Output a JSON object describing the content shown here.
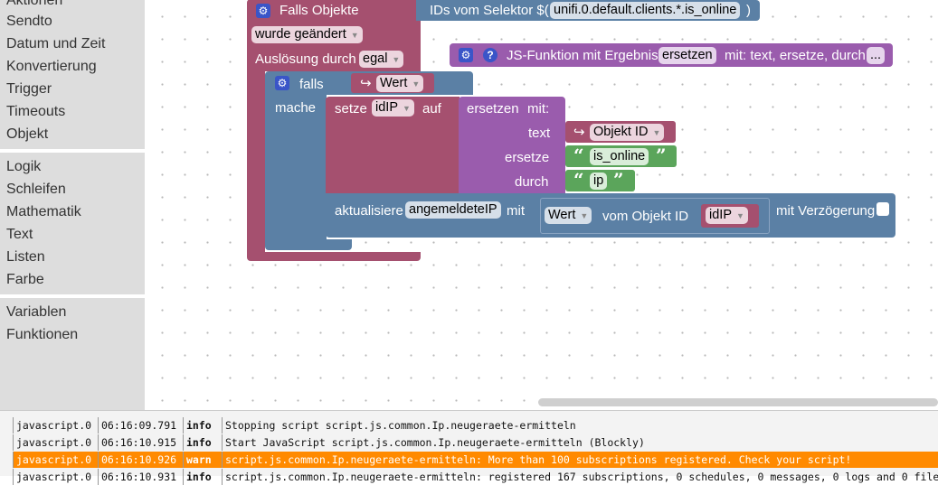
{
  "sidebar": {
    "categories": [
      "Aktionen",
      "Sendto",
      "Datum und Zeit",
      "Konvertierung",
      "Trigger",
      "Timeouts",
      "Objekt",
      "Logik",
      "Schleifen",
      "Mathematik",
      "Text",
      "Listen",
      "Farbe",
      "Variablen",
      "Funktionen"
    ]
  },
  "blocks": {
    "trigger": {
      "title": "Falls Objekte",
      "ids_label": "IDs vom Selektor $(",
      "selector": "unifi.0.default.clients.*.is_online",
      "close_paren": ")",
      "changed": "wurde geändert",
      "triggered_by": "Auslösung durch",
      "trigger_type": "egal"
    },
    "if_block": {
      "if_label": "falls",
      "value": "Wert",
      "do_label": "mache"
    },
    "set_var": {
      "label": "setze",
      "var": "idIP",
      "to": "auf"
    },
    "replace": {
      "label": "ersetzen",
      "with": "mit:",
      "text_label": "text",
      "text_value": "Objekt ID",
      "replace_label": "ersetze",
      "replace_value": "is_online",
      "by_label": "durch",
      "by_value": "ip"
    },
    "js_function": {
      "title": "JS-Funktion mit Ergebnis",
      "name": "ersetzen",
      "params": "mit: text, ersetze, durch",
      "more": "..."
    },
    "update": {
      "label": "aktualisiere",
      "var": "angemeldeteIP",
      "with": "mit",
      "value": "Wert",
      "from_object": "vom Objekt ID",
      "object_var": "idIP",
      "delay": "mit Verzögerung"
    }
  },
  "log": {
    "rows": [
      {
        "source": "javascript.0",
        "time": "06:16:09.791",
        "level": "info",
        "message": "Stopping script script.js.common.Ip.neugeraete-ermitteln"
      },
      {
        "source": "javascript.0",
        "time": "06:16:10.915",
        "level": "info",
        "message": "Start JavaScript script.js.common.Ip.neugeraete-ermitteln (Blockly)"
      },
      {
        "source": "javascript.0",
        "time": "06:16:10.926",
        "level": "warn",
        "message": "script.js.common.Ip.neugeraete-ermitteln: More than 100 subscriptions registered. Check your script!"
      },
      {
        "source": "javascript.0",
        "time": "06:16:10.931",
        "level": "info",
        "message": "script.js.common.Ip.neugeraete-ermitteln: registered 167 subscriptions, 0 schedules, 0 messages, 0 logs and 0 file"
      }
    ]
  },
  "colors": {
    "trigger": "#a5506f",
    "logic": "#5b80a5",
    "text": "#5ba55b",
    "function": "#9a5cad"
  }
}
